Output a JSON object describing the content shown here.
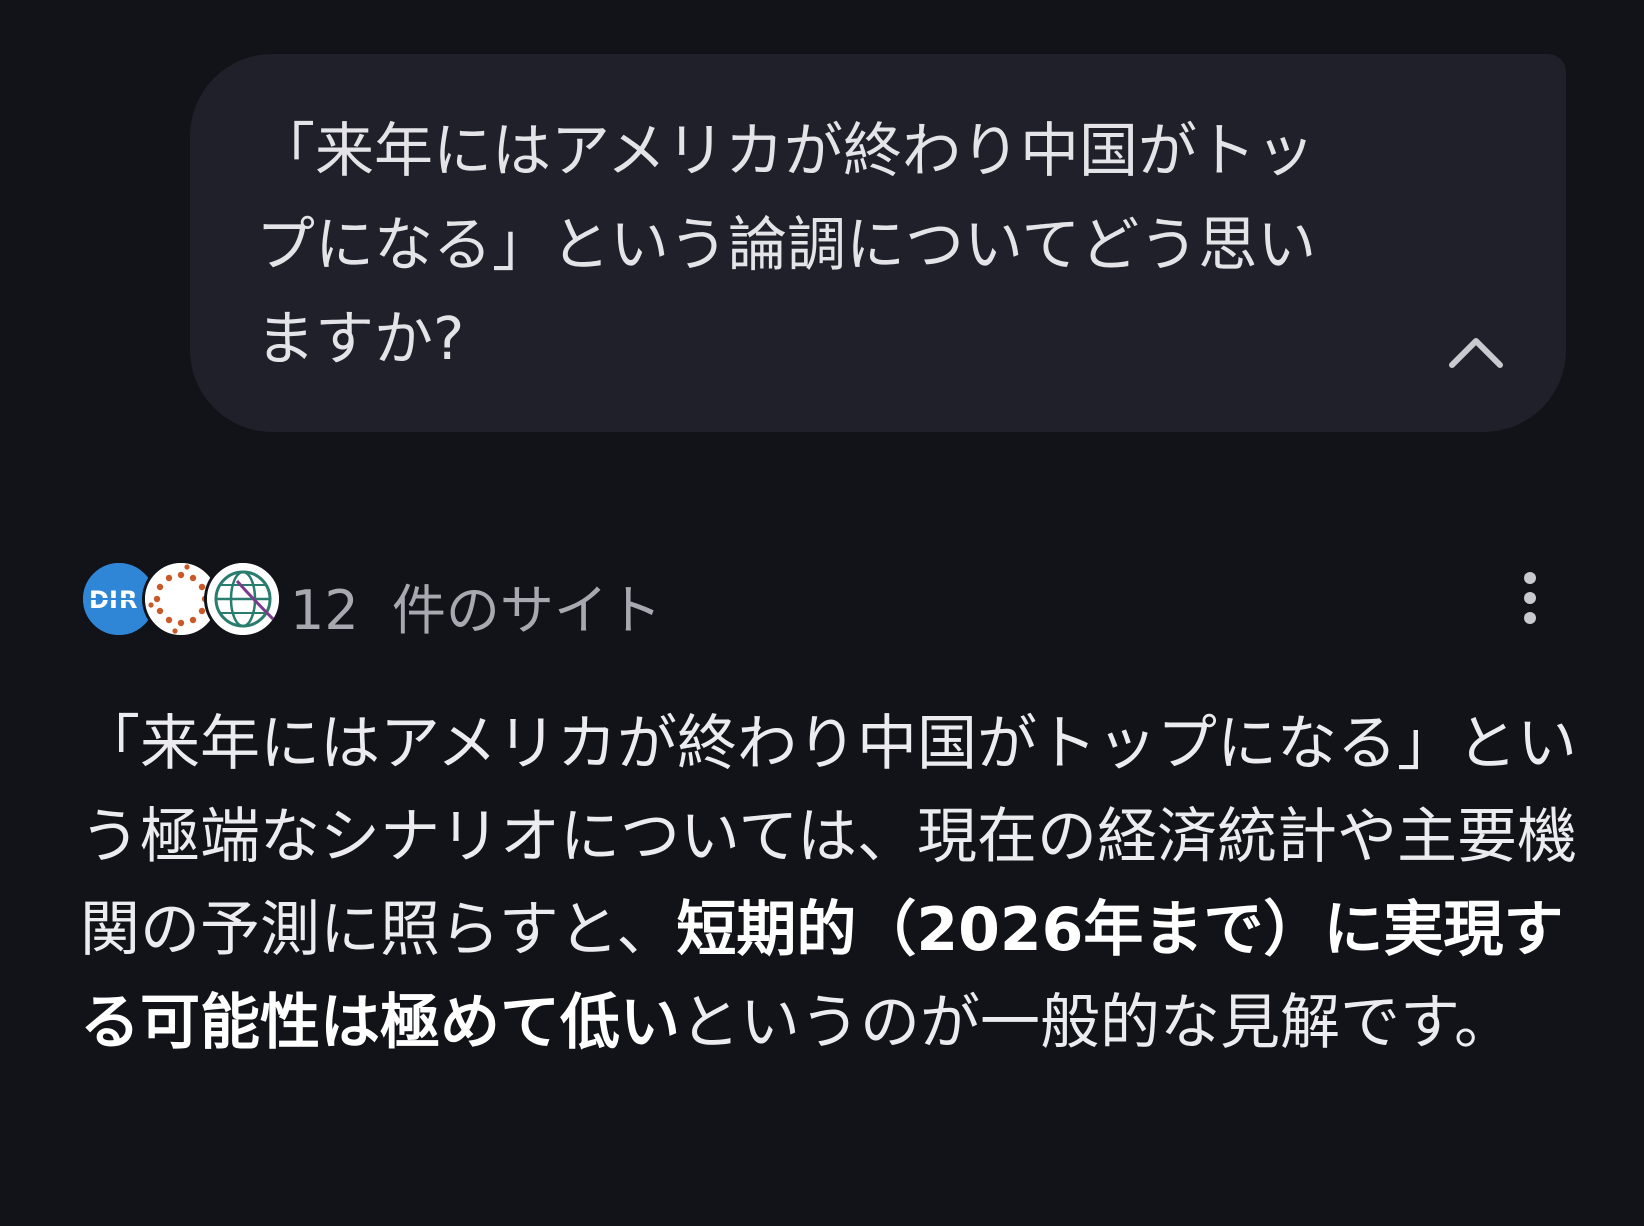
{
  "prompt": {
    "text": "「来年にはアメリカが終わり中国がトップになる」という論調についてどう思いますか?"
  },
  "collapse_icon": "chevron-up-icon",
  "sources": {
    "count": "12",
    "label": "件のサイト",
    "favicons": [
      "dir-logo-icon",
      "dotted-ring-logo-icon",
      "globe-logo-icon"
    ]
  },
  "more_icon": "more-vertical-icon",
  "answer": {
    "part1": "「来年にはアメリカが終わり中国がトップになる」という極端なシナリオについては、現在の経済統計や主要機関の予測に照らすと、",
    "part2_bold": "短期的（2026年まで）に実現する可能性は極めて低い",
    "part3": "というのが一般的な見解です。"
  }
}
